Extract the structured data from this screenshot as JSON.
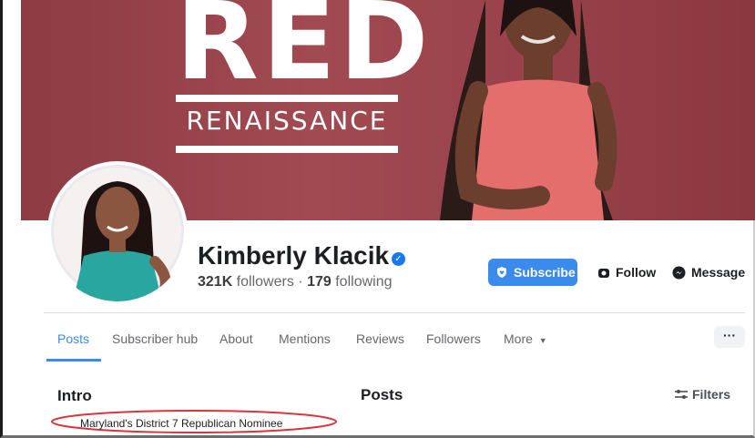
{
  "cover": {
    "title": "RED",
    "subtitle": "RENAISSANCE"
  },
  "profile": {
    "name": "Kimberly Klacik",
    "followers_count": "321K",
    "followers_label": "followers",
    "separator": "·",
    "following_count": "179",
    "following_label": "following"
  },
  "actions": {
    "subscribe_label": "Subscribe",
    "follow_label": "Follow",
    "message_label": "Message"
  },
  "tabs": [
    {
      "label": "Posts",
      "active": true
    },
    {
      "label": "Subscriber hub",
      "active": false
    },
    {
      "label": "About",
      "active": false
    },
    {
      "label": "Mentions",
      "active": false
    },
    {
      "label": "Reviews",
      "active": false
    },
    {
      "label": "Followers",
      "active": false
    },
    {
      "label": "More",
      "active": false
    }
  ],
  "more_menu_label": "···",
  "intro": {
    "heading": "Intro",
    "bio": "Maryland's District 7 Republican Nominee"
  },
  "posts": {
    "heading": "Posts",
    "filters_label": "Filters"
  },
  "colors": {
    "accent": "#3b8bec",
    "cover_bg": "#9a434c",
    "highlight_circle": "#d9343f"
  },
  "icons": {
    "verified": "check-badge-icon",
    "subscribe": "shield-heart-icon",
    "follow": "follow-icon",
    "message": "messenger-icon",
    "more": "chevron-down-icon",
    "filters": "sliders-icon"
  }
}
